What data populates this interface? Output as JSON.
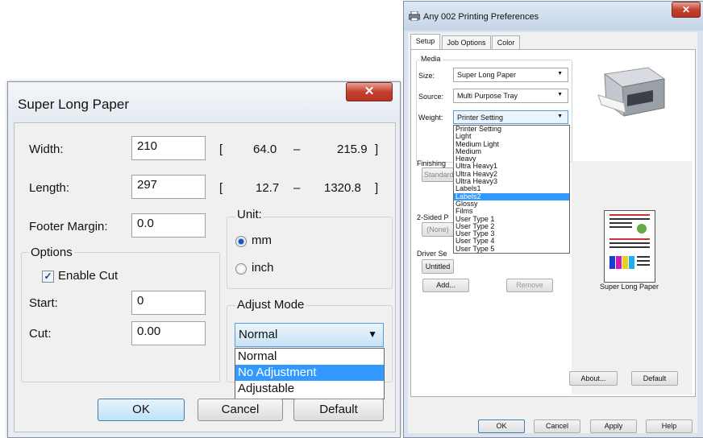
{
  "left_dialog": {
    "title": "Super Long Paper",
    "close_glyph": "✕",
    "width_label": "Width:",
    "width_value": "210",
    "width_range": {
      "open": "[",
      "min": "64.0",
      "dash": "–",
      "max": "215.9",
      "close": "]"
    },
    "length_label": "Length:",
    "length_value": "297",
    "length_range": {
      "open": "[",
      "min": "12.7",
      "dash": "–",
      "max": "1320.8",
      "close": "]"
    },
    "footer_label": "Footer Margin:",
    "footer_value": "0.0",
    "unit": {
      "label": "Unit:",
      "mm": "mm",
      "inch": "inch",
      "selected": "mm"
    },
    "options": {
      "label": "Options",
      "enable_cut": "Enable Cut",
      "enable_cut_checked": true,
      "start_label": "Start:",
      "start_value": "0",
      "cut_label": "Cut:",
      "cut_value": "0.00"
    },
    "adjust_mode": {
      "label": "Adjust Mode",
      "selected": "Normal",
      "options": [
        "Normal",
        "No Adjustment",
        "Adjustable"
      ],
      "highlighted": "No Adjustment"
    },
    "buttons": {
      "ok": "OK",
      "cancel": "Cancel",
      "default": "Default"
    }
  },
  "right_dialog": {
    "title": "Any 002 Printing Preferences",
    "close_glyph": "✕",
    "tabs": [
      "Setup",
      "Job Options",
      "Color"
    ],
    "media": {
      "label": "Media",
      "size_label": "Size:",
      "size_value": "Super Long Paper",
      "source_label": "Source:",
      "source_value": "Multi Purpose Tray",
      "weight_label": "Weight:",
      "weight_value": "Printer Setting",
      "weight_options": [
        "Printer Setting",
        "Light",
        "Medium Light",
        "Medium",
        "Heavy",
        "Ultra Heavy1",
        "Ultra Heavy2",
        "Ultra Heavy3",
        "Labels1",
        "Labels2",
        "Glossy",
        "Films",
        "User Type 1",
        "User Type 2",
        "User Type 3",
        "User Type 4",
        "User Type 5"
      ],
      "weight_highlighted": "Labels2"
    },
    "finishing_label": "Finishing",
    "finishing_value": "Standard",
    "two_sided_label": "2-Sided P",
    "two_sided_value": "(None)",
    "driver_label": "Driver Se",
    "driver_value": "Untitled",
    "add_button": "Add...",
    "remove_button": "Remove",
    "preview_caption": "Super Long Paper",
    "about_button": "About...",
    "default_button": "Default",
    "bottom_buttons": {
      "ok": "OK",
      "cancel": "Cancel",
      "apply": "Apply",
      "help": "Help"
    }
  },
  "colors": {
    "accent": "#3399ff",
    "close_button": "#c7402f",
    "combo_focus": "#569de5"
  }
}
